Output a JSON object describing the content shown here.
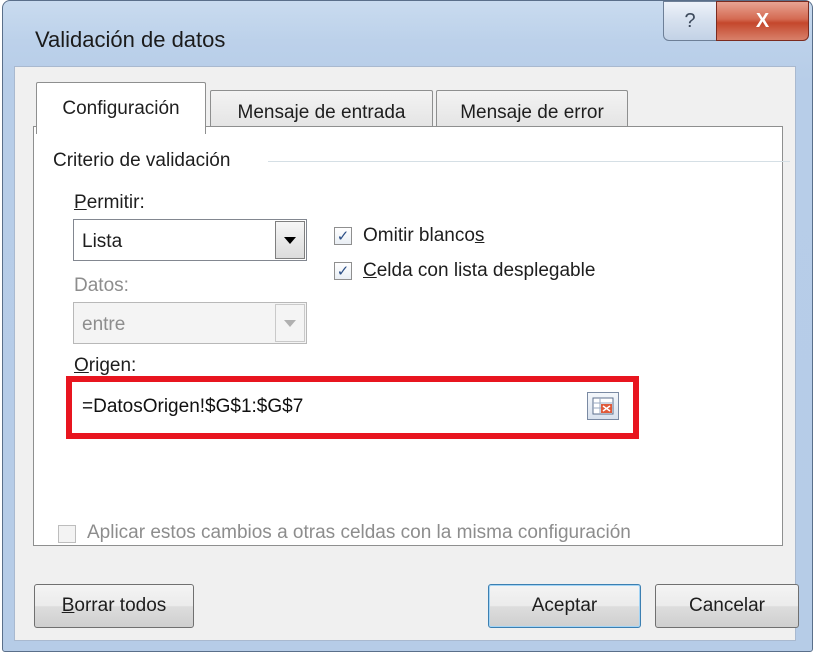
{
  "window": {
    "title": "Validación de datos",
    "help_label": "?",
    "close_label": "X"
  },
  "tabs": [
    {
      "label": "Configuración",
      "active": true
    },
    {
      "label": "Mensaje de entrada",
      "active": false
    },
    {
      "label": "Mensaje de error",
      "active": false
    }
  ],
  "criteria": {
    "group_title": "Criterio de validación",
    "allow_label_u": "P",
    "allow_label_rest": "ermitir:",
    "allow_value": "Lista",
    "data_label": "Datos:",
    "data_value": "entre",
    "ignore_blank_label_pre": "Omitir blanco",
    "ignore_blank_label_u": "s",
    "ignore_blank_checked": true,
    "in_cell_dropdown_label_u": "C",
    "in_cell_dropdown_label_rest": "elda con lista desplegable",
    "in_cell_dropdown_checked": true,
    "source_label_u": "O",
    "source_label_rest": "rigen:",
    "source_value": "=DatosOrigen!$G$1:$G$7"
  },
  "apply_all": {
    "label": "Aplicar estos cambios a otras celdas con la misma configuración",
    "checked": false
  },
  "buttons": {
    "clear_u": "B",
    "clear_rest": "orrar todos",
    "ok": "Aceptar",
    "cancel": "Cancelar"
  },
  "colors": {
    "highlight": "#e8151f",
    "checkmark": "#2c4f86"
  }
}
